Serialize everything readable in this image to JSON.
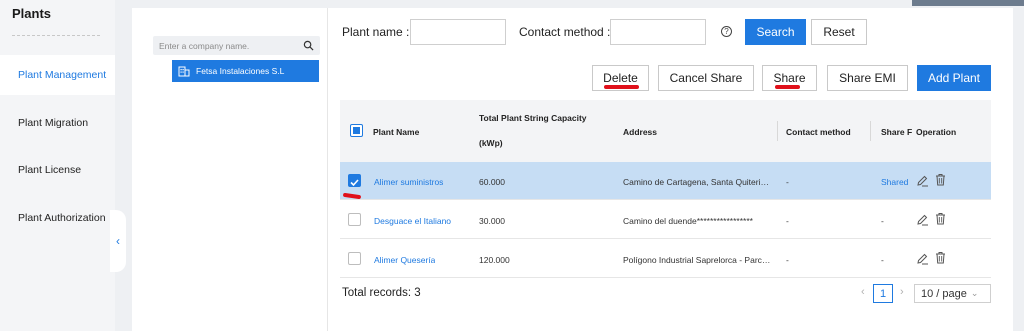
{
  "nav": {
    "title": "Plants",
    "items": [
      {
        "label": "Plant Management",
        "active": true
      },
      {
        "label": "Plant Migration",
        "active": false
      },
      {
        "label": "Plant License",
        "active": false
      },
      {
        "label": "Plant Authorization",
        "active": false
      }
    ]
  },
  "tree": {
    "search_placeholder": "Enter a company name.",
    "node_label": "Fetsa Instalaciones S.L"
  },
  "filters": {
    "plant_name_label": "Plant name :",
    "contact_method_label": "Contact method :",
    "search_label": "Search",
    "reset_label": "Reset"
  },
  "toolbar": {
    "delete_label": "Delete",
    "cancel_share_label": "Cancel Share",
    "share_label": "Share",
    "share_emi_label": "Share EMI",
    "add_plant_label": "Add Plant"
  },
  "table": {
    "headers": {
      "plant_name": "Plant Name",
      "capacity_line1": "Total Plant String Capacity",
      "capacity_line2": "(kWp)",
      "address": "Address",
      "contact_method": "Contact method",
      "share": "Share F",
      "operation": "Operation"
    },
    "rows": [
      {
        "selected": true,
        "plant_name": "Alimer suministros",
        "capacity": "60.000",
        "address": "Camino de Cartagena, Santa Quiteri…",
        "contact_method": "-",
        "share": "Shared"
      },
      {
        "selected": false,
        "plant_name": "Desguace el Italiano",
        "capacity": "30.000",
        "address": "Camino del duende*****************",
        "contact_method": "-",
        "share": "-"
      },
      {
        "selected": false,
        "plant_name": "Alimer Quesería",
        "capacity": "120.000",
        "address": "Polígono Industrial Saprelorca - Parc…",
        "contact_method": "-",
        "share": "-"
      }
    ]
  },
  "footer": {
    "total_records": "Total records: 3",
    "current_page": "1",
    "page_size": "10 / page"
  },
  "colors": {
    "accent": "#1f7ae0",
    "selected_row": "#c6ddf4",
    "annotation": "#e0101a"
  }
}
